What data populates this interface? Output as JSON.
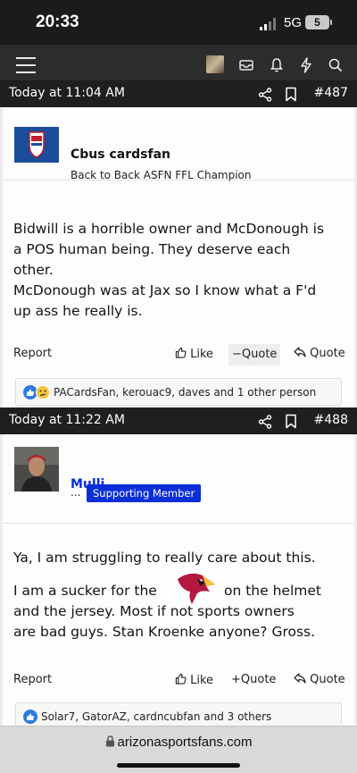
{
  "status_bar": {
    "time": "20:33",
    "network": "5G",
    "battery": "5"
  },
  "site": {
    "url": "arizonasportsfans.com"
  },
  "posts": [
    {
      "date": "Today at 11:04 AM",
      "number": "#487",
      "username": "Cbus cardsfan",
      "user_title": "Back to Back ASFN FFL Champion",
      "message_lines": [
        "Bidwill is a horrible owner and McDonough is",
        "a POS human being. They deserve each",
        "other.",
        "McDonough was at Jax so I know what a F'd",
        "up ass he really is."
      ],
      "actions": {
        "report": "Report",
        "like": "Like",
        "unquote": "Quote",
        "reply": "Quote"
      },
      "reactions": "PACardsFan, kerouac9, daves and 1 other person"
    },
    {
      "date": "Today at 11:22 AM",
      "number": "#488",
      "username": "Mulli",
      "user_title_prefix": "...",
      "badge": "Supporting Member",
      "message_lines": [
        "Ya, I am struggling to really care about this.",
        "I am a sucker for the",
        "on the helmet",
        "and the jersey. Most if not sports owners",
        "are bad guys. Stan Kroenke anyone? Gross."
      ],
      "actions": {
        "report": "Report",
        "like": "Like",
        "quote": "Quote",
        "reply": "Quote"
      },
      "reactions": "Solar7, GatorAZ, cardncubfan and 3 others"
    }
  ],
  "icons": {
    "menu": "hamburger-icon",
    "inbox": "inbox-icon",
    "alerts": "bell-icon",
    "whats_new": "bolt-icon",
    "search": "search-icon",
    "share": "share-icon",
    "bookmark": "bookmark-icon",
    "lock": "lock-icon"
  },
  "colors": {
    "header": "#1f1f1f",
    "badge": "#0a2fd8",
    "username_link": "#0a2fd8",
    "like_reaction": "#2d7be0"
  }
}
